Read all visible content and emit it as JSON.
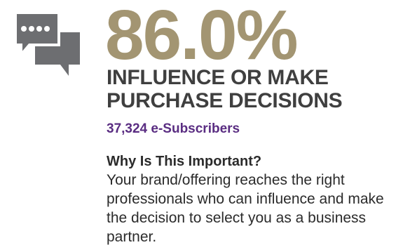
{
  "stat": {
    "value": "86.0%",
    "headline_line1": "INFLUENCE OR MAKE",
    "headline_line2": "PURCHASE DECISIONS",
    "subscribers": "37,324 e-Subscribers"
  },
  "why": {
    "title": "Why Is This Important?",
    "body": "Your brand/offering reaches the right professionals who can influence and make the decision to select you as a business partner."
  },
  "icon": {
    "name": "chat-bubbles-icon"
  },
  "colors": {
    "stat_gold": "#a39572",
    "headline_gray": "#3f3f3f",
    "subscribers_purple": "#5a2d82",
    "icon_gray": "#6d6e71",
    "text_dark": "#2b2b2b"
  }
}
